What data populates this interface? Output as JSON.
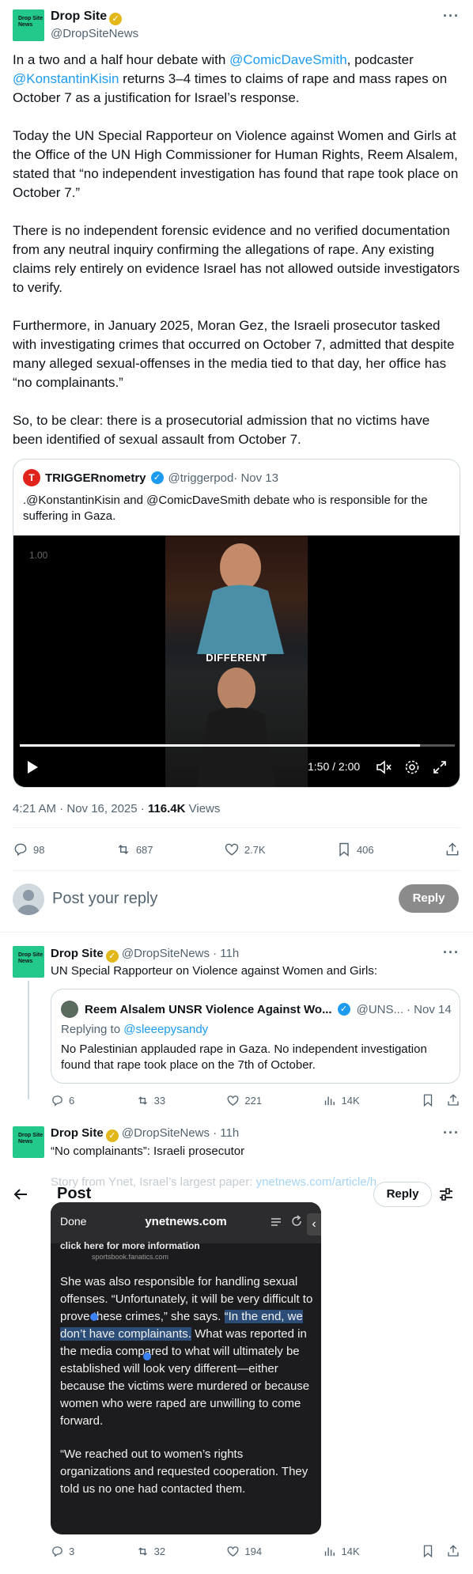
{
  "main_post": {
    "author_name": "Drop Site",
    "author_handle": "@DropSiteNews",
    "avatar_text": "Drop Site News",
    "para1_a": "In a two and a half hour debate with ",
    "para1_mention1": "@ComicDaveSmith",
    "para1_b": ", podcaster ",
    "para1_mention2": "@KonstantinKisin",
    "para1_c": " returns 3–4 times to claims of rape and mass rapes on October 7 as a justification for Israel’s response.",
    "para2": "Today the UN Special Rapporteur on Violence against Women and Girls at the Office of the UN High Commissioner for Human Rights, Reem Alsalem, stated that “no independent investigation has found that rape took place on October 7.”",
    "para3": "There is no independent forensic evidence and no verified documentation from any neutral inquiry confirming the allegations of rape. Any existing claims rely entirely on evidence Israel has not allowed outside investigators to verify.",
    "para4": "Furthermore, in January 2025, Moran Gez, the Israeli prosecutor tasked with investigating crimes that occurred on October 7, admitted that despite many alleged sexual-offenses in the media tied to that day, her office has “no complainants.”",
    "para5": "So, to be clear: there is a prosecutorial admission that no victims have been identified of sexual assault from October 7.",
    "timestamp": "4:21 AM · Nov 16, 2025 · ",
    "views_count": "116.4K",
    "views_label": " Views",
    "stats": {
      "replies": "98",
      "reposts": "687",
      "likes": "2.7K",
      "bookmarks": "406"
    }
  },
  "quoted": {
    "name": "TRIGGERnometry",
    "handle": "@triggerpod",
    "date": " · Nov 13",
    "text": ".@KonstantinKisin and @ComicDaveSmith debate who is responsible for the suffering in Gaza.",
    "video_speed": "1.00",
    "caption": "DIFFERENT",
    "time": "1:50 / 2:00",
    "progress": 0.92
  },
  "reply_box": {
    "placeholder": "Post your reply",
    "button": "Reply"
  },
  "reply1": {
    "name": "Drop Site",
    "handle": "@DropSiteNews",
    "time": " · 11h",
    "text": "UN Special Rapporteur on Violence against Women and Girls:",
    "quote_name": "Reem Alsalem UNSR Violence Against Wo...",
    "quote_handle": "@UNS...",
    "quote_date": " · Nov 14",
    "quote_reply_prefix": "Replying to ",
    "quote_reply_handle": "@sleeepysandy",
    "quote_text": "No Palestinian applauded rape in Gaza. No independent investigation found that rape took place on the 7th of October.",
    "stats": {
      "replies": "6",
      "reposts": "33",
      "likes": "221",
      "views": "14K"
    }
  },
  "reply2": {
    "name": "Drop Site",
    "handle": "@DropSiteNews",
    "time": " · 11h",
    "text": "“No complainants”: Israeli prosecutor",
    "faded_text": "Story from Ynet, Israel’s largest paper: ",
    "faded_link": "ynetnews.com/article/h...",
    "overlay_title": "Post",
    "overlay_reply": "Reply",
    "phone_done": "Done",
    "phone_url": "ynetnews.com",
    "phone_top1": "click here for more information",
    "phone_top2": "sportsbook.fanatics.com",
    "article_a": "She was also responsible for handling sexual offenses. “Unfortunately, it will be very difficult to prove these crimes,” she says. ",
    "article_highlight": "“In the end, we don’t have complainants.",
    "article_b": " What was reported in the media compared to what will ultimately be established will look very different—either because the victims were murdered or because women who were raped are unwilling to come forward.",
    "article_c": "“We reached out to women’s rights organizations and requested cooperation. They told us no one had contacted them.",
    "stats": {
      "replies": "3",
      "reposts": "32",
      "likes": "194",
      "views": "14K"
    }
  },
  "colors": {
    "accent": "#1d9bf0",
    "brand_green": "#22c98b",
    "gold": "#e2b719"
  },
  "icons": [
    "more-icon",
    "verified-icon",
    "reply-icon",
    "repost-icon",
    "like-icon",
    "bookmark-icon",
    "share-icon",
    "views-icon",
    "play-icon",
    "mute-icon",
    "settings-icon",
    "fullscreen-icon",
    "back-arrow-icon",
    "sliders-icon"
  ]
}
